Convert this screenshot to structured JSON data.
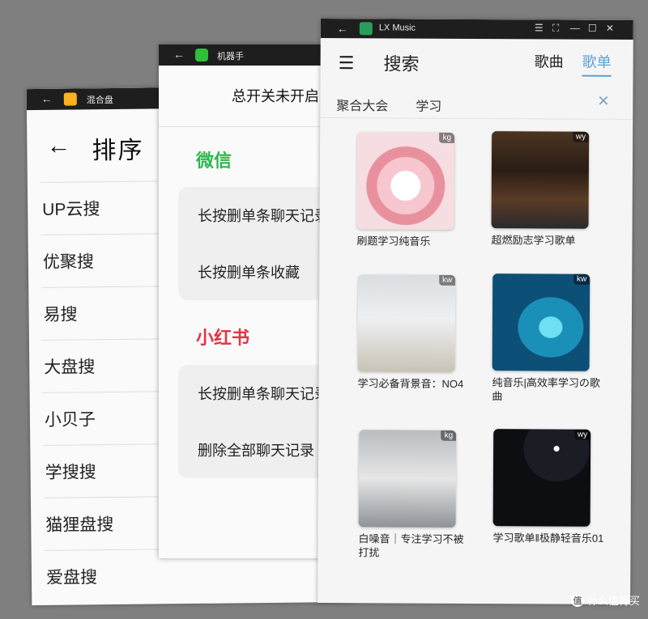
{
  "window1": {
    "titlebar": {
      "back": "←",
      "title": "混合盘"
    },
    "back": "←",
    "title": "排序",
    "items": [
      "UP云搜",
      "优聚搜",
      "易搜",
      "大盘搜",
      "小贝子",
      "学搜搜",
      "猫狸盘搜",
      "爱盘搜"
    ],
    "menu_icon": "menu-icon"
  },
  "window2": {
    "titlebar": {
      "back": "←",
      "title": "机器手"
    },
    "master_label": "总开关未开启",
    "sections": [
      {
        "title": "微信",
        "color": "#2db84d",
        "rows": [
          "长按删单条聊天记录",
          "长按删单条收藏"
        ]
      },
      {
        "title": "小红书",
        "color": "#e03546",
        "rows": [
          "长按删单条聊天记录",
          "删除全部聊天记录"
        ]
      }
    ]
  },
  "window3": {
    "titlebar": {
      "back": "←",
      "title": "LX Music",
      "controls": [
        "☰",
        "⛶",
        "—",
        "☐",
        "✕"
      ]
    },
    "header": {
      "title": "搜索",
      "tab_songs": "歌曲",
      "tab_lists": "歌单",
      "accent": "#5aa3d6"
    },
    "search": {
      "source": "聚合大会",
      "query": "学习",
      "clear": "✕"
    },
    "cards": [
      {
        "badge": "kg",
        "title": "刷题学习纯音乐"
      },
      {
        "badge": "wy",
        "title": "超燃励志学习歌单"
      },
      {
        "badge": "kw",
        "title": "学习必备背景音：NO4"
      },
      {
        "badge": "kw",
        "title": "纯音乐|高效率学习の歌曲"
      },
      {
        "badge": "kg",
        "title": "白噪音｜专注学习不被打扰"
      },
      {
        "badge": "wy",
        "title": "学习歌单‖极静轻音乐01"
      }
    ]
  },
  "watermark": {
    "icon": "值",
    "text": "什么值得买"
  }
}
